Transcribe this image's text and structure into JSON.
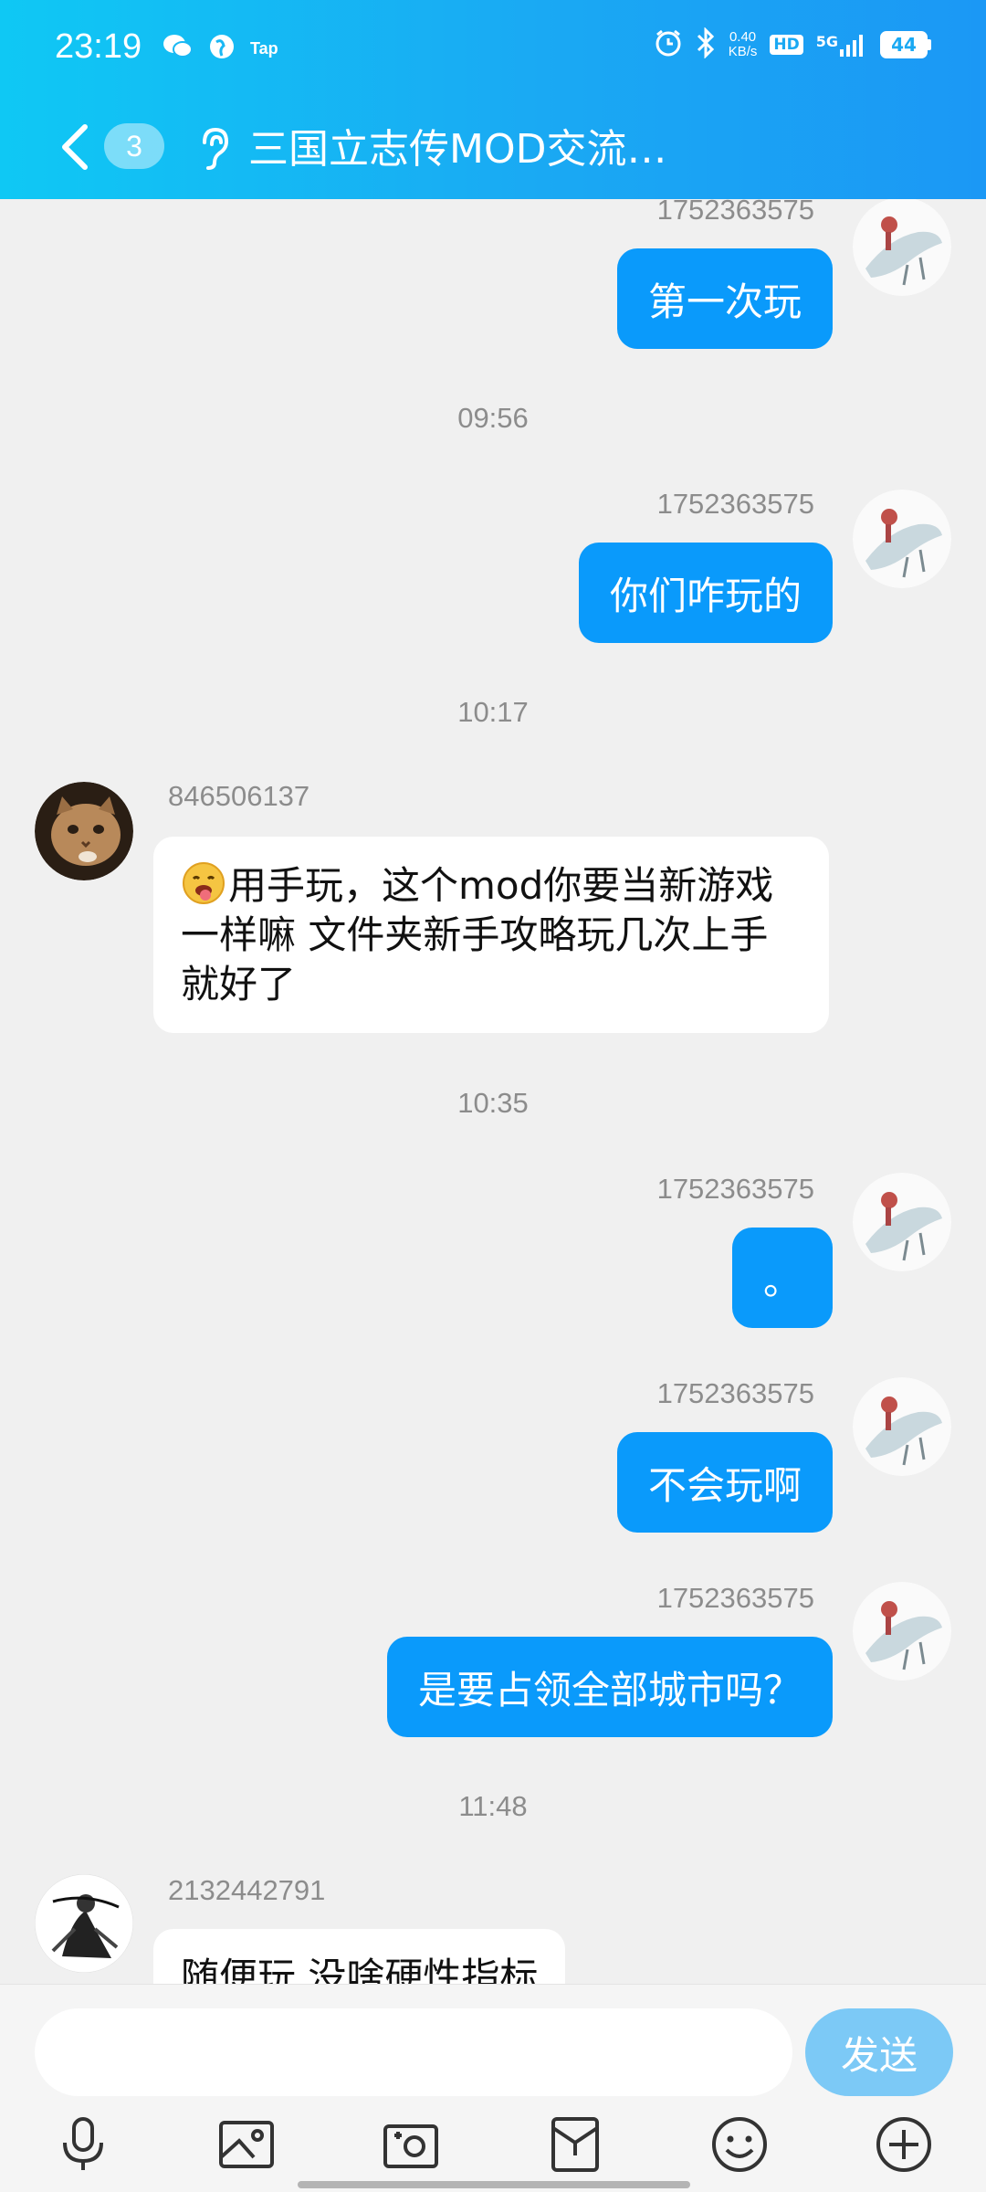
{
  "status_bar": {
    "time": "23:19",
    "tap_label": "Tap",
    "net_speed_value": "0.40",
    "net_speed_unit": "KB/s",
    "hd_label": "HD",
    "network_label": "5G",
    "battery_level": "44"
  },
  "header": {
    "unread_count": "3",
    "title": "三国立志传MOD交流…"
  },
  "messages": [
    {
      "type": "outgoing",
      "sender": "1752363575",
      "text": "第一次玩"
    },
    {
      "type": "time",
      "text": "09:56"
    },
    {
      "type": "outgoing",
      "sender": "1752363575",
      "text": "你们咋玩的"
    },
    {
      "type": "time",
      "text": "10:17"
    },
    {
      "type": "incoming",
      "sender": "846506137",
      "text": "用手玩，这个mod你要当新游戏一样嘛  文件夹新手攻略玩几次上手就好了"
    },
    {
      "type": "time",
      "text": "10:35"
    },
    {
      "type": "outgoing",
      "sender": "1752363575",
      "text": "。"
    },
    {
      "type": "outgoing",
      "sender": "1752363575",
      "text": "不会玩啊"
    },
    {
      "type": "outgoing",
      "sender": "1752363575",
      "text": "是要占领全部城市吗？"
    },
    {
      "type": "time",
      "text": "11:48"
    },
    {
      "type": "incoming",
      "sender": "2132442791",
      "text": "随便玩 没啥硬性指标"
    }
  ],
  "input": {
    "placeholder": "",
    "send_label": "发送"
  },
  "toolbar": {
    "items": [
      "microphone-icon",
      "image-icon",
      "camera-icon",
      "red-packet-icon",
      "emoji-icon",
      "plus-icon"
    ]
  },
  "colors": {
    "header_start": "#0fc8f4",
    "header_end": "#1b98f5",
    "outgoing_bubble": "#0a9afb",
    "send_button": "#7cc9f6"
  }
}
